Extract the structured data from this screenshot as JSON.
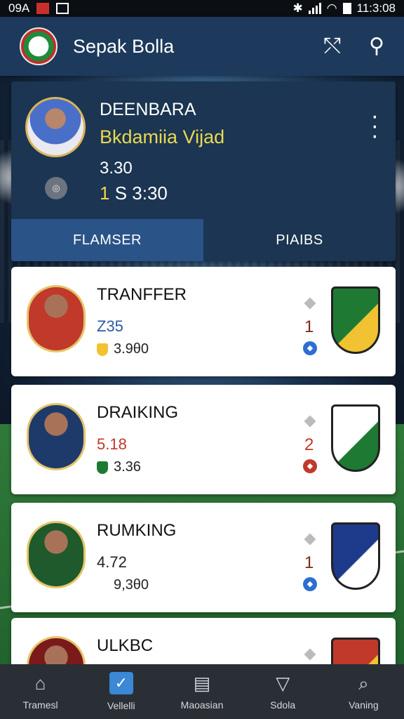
{
  "status_bar": {
    "left_text": "09A",
    "time": "11:3:08"
  },
  "app_bar": {
    "title": "Sepak Bolla",
    "share_icon": "share-icon",
    "search_icon": "search-icon"
  },
  "profile": {
    "name": "DEENBARA",
    "team": "Bkdamiia Vijad",
    "stat_line_1": "3.30",
    "stat_line_2_highlight": "1",
    "stat_line_2_rest": "S 3:30",
    "badge_text": "",
    "tabs": [
      {
        "label": "FLAMSER",
        "active": true
      },
      {
        "label": "PIAIBS",
        "active": false
      }
    ]
  },
  "players": [
    {
      "title": "TRANFFER",
      "value": "Z35",
      "value_color": "#2c5aa0",
      "sub": "3.9θ0",
      "rank": "1",
      "rank_color": "#7a2a1a",
      "dot_color": "#2c6fd1",
      "avatar_color": "#c0392b",
      "crest_color": "#1e7a33",
      "crest_accent": "#f1c232"
    },
    {
      "title": "DRAIKING",
      "value": "5.18",
      "value_color": "#c0392b",
      "sub": "3.36",
      "rank": "2",
      "rank_color": "#c0392b",
      "dot_color": "#c0392b",
      "avatar_color": "#1e3a6b",
      "crest_color": "#ffffff",
      "crest_accent": "#1e7a33"
    },
    {
      "title": "RUMKING",
      "value": "4.72",
      "value_color": "#222222",
      "sub": "9,3θ0",
      "rank": "1",
      "rank_color": "#7a2a1a",
      "dot_color": "#2c6fd1",
      "avatar_color": "#1e5a2b",
      "crest_color": "#1e3a8a",
      "crest_accent": "#ffffff"
    },
    {
      "title": "ULKBC",
      "value": "",
      "value_color": "#c0392b",
      "sub": "",
      "rank": "",
      "rank_color": "#7a2a1a",
      "dot_color": "#2c6fd1",
      "avatar_color": "#7a1a1a",
      "crest_color": "#c0392b",
      "crest_accent": "#f1c232"
    }
  ],
  "bottom_nav": [
    {
      "label": "Tramesl",
      "icon": "home-icon",
      "glyph": "⌂",
      "active": false
    },
    {
      "label": "Vellelli",
      "icon": "check-icon",
      "glyph": "✓",
      "active": true
    },
    {
      "label": "Maoasian",
      "icon": "chart-icon",
      "glyph": "▤",
      "active": false
    },
    {
      "label": "Sdola",
      "icon": "shield-icon",
      "glyph": "▽",
      "active": false
    },
    {
      "label": "Vaning",
      "icon": "search-icon",
      "glyph": "⌕",
      "active": false
    }
  ]
}
